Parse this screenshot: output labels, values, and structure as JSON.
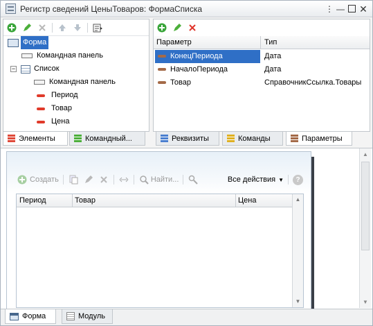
{
  "window": {
    "title": "Регистр сведений ЦеныТоваров: ФормаСписка"
  },
  "elements_panel": {
    "tree": [
      {
        "label": "Форма"
      },
      {
        "label": "Командная панель"
      },
      {
        "label": "Список"
      },
      {
        "label": "Командная панель"
      },
      {
        "label": "Период"
      },
      {
        "label": "Товар"
      },
      {
        "label": "Цена"
      }
    ],
    "tabs": [
      {
        "label": "Элементы"
      },
      {
        "label": "Командный..."
      }
    ]
  },
  "params_panel": {
    "columns": [
      "Параметр",
      "Тип"
    ],
    "rows": [
      {
        "name": "КонецПериода",
        "type": "Дата"
      },
      {
        "name": "НачалоПериода",
        "type": "Дата"
      },
      {
        "name": "Товар",
        "type": "СправочникСсылка.Товары"
      }
    ],
    "tabs": [
      {
        "label": "Реквизиты"
      },
      {
        "label": "Команды"
      },
      {
        "label": "Параметры"
      }
    ]
  },
  "preview": {
    "create_label": "Создать",
    "find_label": "Найти...",
    "all_actions_label": "Все действия",
    "help_label": "?",
    "columns": [
      "Период",
      "Товар",
      "Цена"
    ]
  },
  "bottom_tabs": [
    {
      "label": "Форма"
    },
    {
      "label": "Модуль"
    }
  ]
}
